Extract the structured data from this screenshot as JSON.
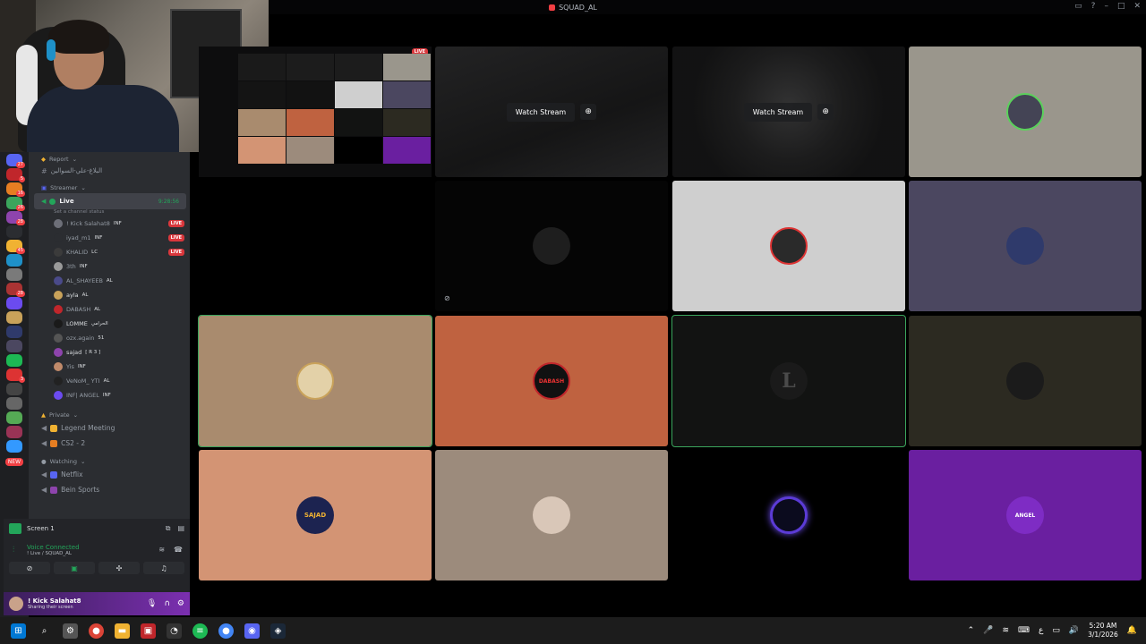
{
  "window": {
    "title": "SQUAD_AL"
  },
  "rail": {
    "badges": [
      "27",
      "5",
      "16",
      "26",
      "28",
      "",
      "45",
      "",
      "",
      "28",
      "",
      "",
      "",
      "",
      "",
      "3",
      "",
      "",
      "",
      "",
      ""
    ],
    "new_label": "NEW"
  },
  "sidebar": {
    "top_category": "Report",
    "top_channel": "البلاغ-علي-السوالين",
    "category_streamer": "Streamer",
    "active_channel": {
      "name": "Live",
      "time": "9:28:56",
      "sub": "Set a channel status"
    },
    "members": [
      {
        "name": "! Kick Salahat8",
        "tag": "INF",
        "live": "LIVE"
      },
      {
        "name": "iyad_m1",
        "tag": "INF",
        "live": "LIVE"
      },
      {
        "name": "KHALID",
        "tag": "LC",
        "live": "LIVE"
      },
      {
        "name": "3th",
        "tag": "INF",
        "live": ""
      },
      {
        "name": "AL_SHAYEEB",
        "tag": "AL",
        "live": ""
      },
      {
        "name": "ayla",
        "tag": "AL",
        "live": ""
      },
      {
        "name": "DABASH",
        "tag": "AL",
        "live": ""
      },
      {
        "name": "LOMME",
        "tag": "الحرامي",
        "live": ""
      },
      {
        "name": "ozx.again",
        "tag": "51",
        "live": ""
      },
      {
        "name": "sajad",
        "tag": "[ R 3 ]",
        "live": ""
      },
      {
        "name": "Yis",
        "tag": "INF",
        "live": ""
      },
      {
        "name": "VeNoM_ YTI",
        "tag": "AL",
        "live": ""
      },
      {
        "name": "INF| ANGEL",
        "tag": "INF",
        "live": ""
      }
    ],
    "category_private": "Private",
    "private_channels": [
      "Legend Meeting",
      "CS2 - 2"
    ],
    "category_watching": "Watching",
    "watching_channels": [
      "Netflix",
      "Bein Sports"
    ]
  },
  "rtc": {
    "screen_label": "Screen 1",
    "voice_status": "Voice Connected",
    "voice_sub": "! Live / SQUAD_AL"
  },
  "user": {
    "name": "! Kick Salahat8",
    "status": "Sharing their screen"
  },
  "tiles": {
    "watch_label": "Watch Stream",
    "live_tag": "LIVE",
    "avatars": {
      "r2c1": "L",
      "r3c0": "SAJAD",
      "r2c2": "DABASH",
      "r3c3": "ANGEL"
    }
  },
  "taskbar": {
    "time": "5:20 AM",
    "date": "3/1/2026",
    "lang": "ع"
  },
  "colors": {
    "accent_green": "#23a55a",
    "live_red": "#da373c",
    "discord_blurple": "#5865f2"
  }
}
